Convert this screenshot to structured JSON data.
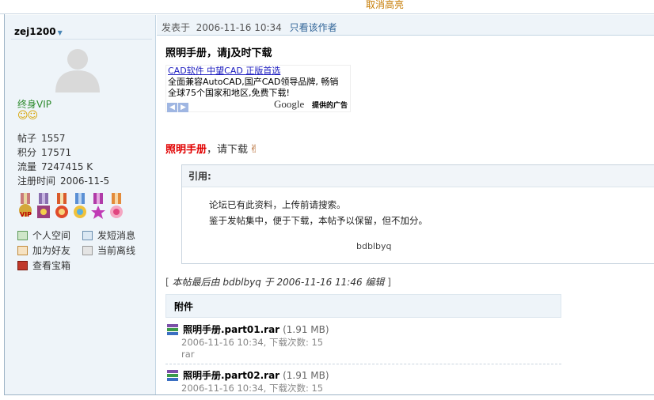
{
  "topbar": {
    "cancel_highlight": "取消高亮"
  },
  "user": {
    "name": "zej1200",
    "rank": "终身VIP",
    "smileys": "☺☺",
    "stats": [
      {
        "label": "帖子",
        "value": "1557"
      },
      {
        "label": "积分",
        "value": "17571"
      },
      {
        "label": "流量",
        "value": "7247415 K"
      },
      {
        "label": "注册时间",
        "value": "2006-11-5"
      }
    ],
    "actions": {
      "profile": "个人空间",
      "message": "发短消息",
      "add_friend": "加为好友",
      "offline": "当前离线",
      "treasure": "查看宝箱"
    }
  },
  "post": {
    "posted_label": "发表于",
    "posted_time": "2006-11-16 10:34",
    "author_only": "只看该作者",
    "title": "照明手册，请j及时下载",
    "ad": {
      "link": "CAD软件 中望CAD 正版首选",
      "line1": "全面兼容AutoCAD,国产CAD领导品牌, 畅销",
      "line2": "全球75个国家和地区,免费下载!",
      "google": "Google",
      "provided": "提供的广告"
    },
    "message_red": "照明手册",
    "message_rest": "，请下载",
    "quote": {
      "heading": "引用:",
      "line1": "论坛已有此资料，上传前请搜索。",
      "line2": "鉴于发帖集中，便于下载，本帖予以保留，但不加分。",
      "sign": "bdblbyq"
    },
    "edited": "本帖最后由 bdblbyq 于 2006-11-16 11:46 编辑",
    "attachments": {
      "heading": "附件",
      "files": [
        {
          "name": "照明手册.part01.rar",
          "size": "(1.91 MB)",
          "meta": "2006-11-16 10:34, 下载次数: 15",
          "type": "rar"
        },
        {
          "name": "照明手册.part02.rar",
          "size": "(1.91 MB)",
          "meta": "2006-11-16 10:34, 下载次数: 15"
        }
      ]
    }
  }
}
